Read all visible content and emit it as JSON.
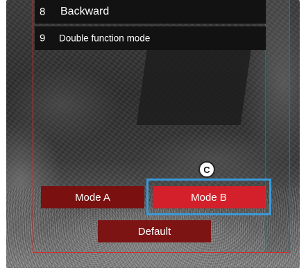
{
  "menu": {
    "rows": [
      {
        "number": "8",
        "label": "Backward"
      },
      {
        "number": "9",
        "label": "Double function mode"
      }
    ]
  },
  "buttons": {
    "mode_a": "Mode A",
    "mode_b": "Mode B",
    "default": "Default"
  },
  "callout": {
    "label": "C",
    "highlight_color": "#3a9ad9"
  },
  "colors": {
    "frame": "#d62b2b",
    "mode_a_bg": "#7a1010",
    "mode_b_bg": "#d3202a",
    "default_bg": "#7d1414"
  }
}
